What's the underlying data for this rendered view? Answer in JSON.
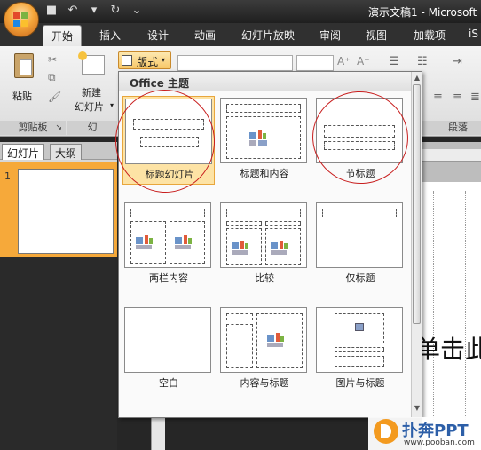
{
  "window": {
    "title": "演示文稿1 - Microsoft"
  },
  "ribbon_tabs": [
    {
      "label": "开始",
      "active": true
    },
    {
      "label": "插入"
    },
    {
      "label": "设计"
    },
    {
      "label": "动画"
    },
    {
      "label": "幻灯片放映"
    },
    {
      "label": "审阅"
    },
    {
      "label": "视图"
    },
    {
      "label": "加载项"
    },
    {
      "label": "iS"
    }
  ],
  "ribbon": {
    "paste_label": "粘贴",
    "new_slide_label": "新建\n幻灯片",
    "new_slide_line1": "新建",
    "new_slide_line2": "幻灯片",
    "layout_button_label": "版式",
    "clipboard_group": "剪贴板",
    "slides_group_partial": "幻",
    "paragraph_group": "段落"
  },
  "left_pane": {
    "tabs": [
      "幻灯片",
      "大纲"
    ],
    "slide_number": "1"
  },
  "dropdown": {
    "title": "Office 主题",
    "layouts": [
      {
        "label": "标题幻灯片",
        "selected": true
      },
      {
        "label": "标题和内容"
      },
      {
        "label": "节标题"
      },
      {
        "label": "两栏内容"
      },
      {
        "label": "比较"
      },
      {
        "label": "仅标题"
      },
      {
        "label": "空白"
      },
      {
        "label": "内容与标题"
      },
      {
        "label": "图片与标题"
      }
    ]
  },
  "slide": {
    "placeholder_text": "单击此"
  },
  "watermark": {
    "brand": "扑奔PPT",
    "url": "www.pooban.com"
  },
  "colors": {
    "selection_fill": "#fde3a5",
    "annotation_red": "#c81e1e",
    "slide_pane_orange": "#f6a93a"
  }
}
